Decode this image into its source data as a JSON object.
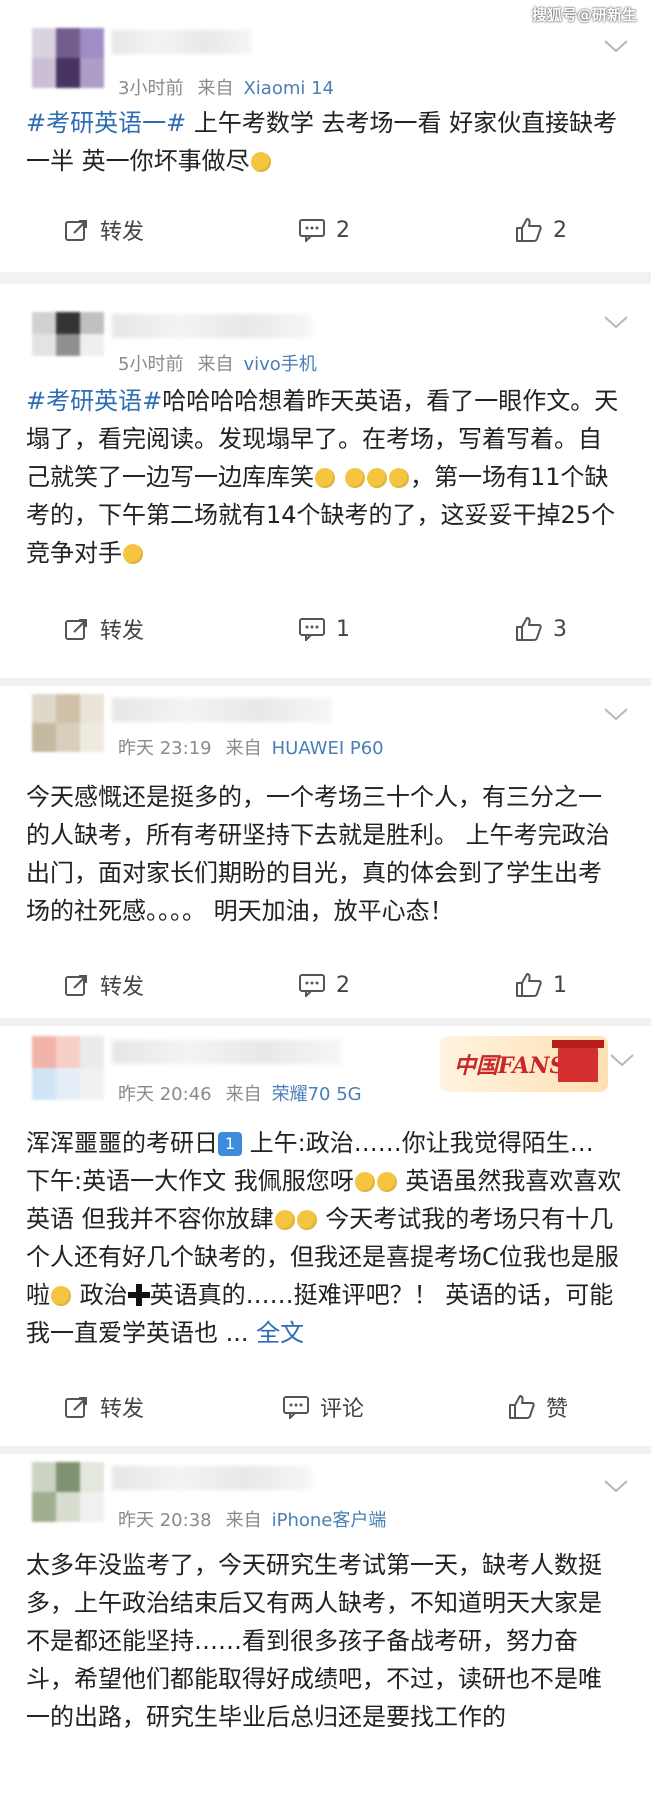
{
  "watermark": "搜狐号@研新生",
  "actions_labels": {
    "repost": "转发"
  },
  "posts": [
    {
      "time": "3小时前",
      "from_label": "来自",
      "source": "Xiaomi 14",
      "tag": "#考研英语一#",
      "text": " 上午考数学 去考场一看 好家伙直接缺考一半 英一你坏事做尽",
      "comment": "2",
      "like": "2"
    },
    {
      "time": "5小时前",
      "from_label": "来自",
      "source": "vivo手机",
      "tag": "#考研英语#",
      "text1": "哈哈哈哈想着昨天英语，看了一眼作文。天塌了，看完阅读。发现塌早了。在考场，写着写着。自己就笑了一边写一边库库笑",
      "text2": "，第一场有11个缺考的，下午第二场就有14个缺考的了，这妥妥干掉25个竞争对手",
      "comment": "1",
      "like": "3"
    },
    {
      "time": "昨天 23:19",
      "from_label": "来自",
      "source": "HUAWEI P60",
      "text": "今天感慨还是挺多的，一个考场三十个人，有三分之一的人缺考，所有考研坚持下去就是胜利。 上午考完政治出门，面对家长们期盼的目光，真的体会到了学生出考场的社死感。。。。 明天加油，放平心态！",
      "comment": "2",
      "like": "1"
    },
    {
      "time": "昨天 20:46",
      "from_label": "来自",
      "source": "荣耀70 5G",
      "badge": "中国FANS",
      "text_a": "浑浑噩噩的考研日",
      "num": "1",
      "text_b": " 上午:政治……你让我觉得陌生… 下午:英语一大作文 我佩服您呀",
      "text_c": " 英语虽然我喜欢喜欢英语 但我并不容你放肆",
      "text_d": " 今天考试我的考场只有十几个人还有好几个缺考的，但我还是喜提考场C位我也是服啦",
      "text_e": " 政治",
      "text_f": "英语真的……挺难评吧？！ 英语的话，可能我一直爱学英语也 ... ",
      "more": "全文",
      "comment": "评论",
      "like": "赞"
    },
    {
      "time": "昨天 20:38",
      "from_label": "来自",
      "source": "iPhone客户端",
      "text": "太多年没监考了，今天研究生考试第一天，缺考人数挺多，上午政治结束后又有两人缺考，不知道明天大家是不是都还能坚持……看到很多孩子备战考研，努力奋斗，希望他们都能取得好成绩吧，不过，读研也不是唯一的出路，研究生毕业后总归还是要找工作的"
    }
  ]
}
